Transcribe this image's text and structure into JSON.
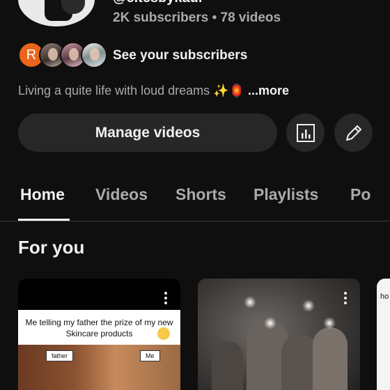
{
  "channel": {
    "handle": "@citesbykaur",
    "stats": "2K subscribers • 78 videos",
    "see_subscribers": "See your subscribers",
    "subscriber_initial": "R",
    "bio": "Living a quite life with loud dreams ✨🏮",
    "more": "...more"
  },
  "actions": {
    "manage_videos": "Manage videos"
  },
  "tabs": [
    {
      "label": "Home"
    },
    {
      "label": "Videos"
    },
    {
      "label": "Shorts"
    },
    {
      "label": "Playlists"
    },
    {
      "label": "Po"
    }
  ],
  "section": {
    "title": "For you"
  },
  "cards": [
    {
      "caption": "Me telling my father the prize of my new Skincare products",
      "label_left": "father",
      "label_right": "Me"
    },
    {},
    {
      "caption_partial": "ho"
    }
  ],
  "colors": {
    "background": "#0f0f0f",
    "button": "#272727",
    "avatar_accent": "#e9651b",
    "muted_text": "#aaaaaa"
  },
  "icons": [
    "kebab-menu-icon",
    "analytics-icon",
    "edit-pencil-icon"
  ]
}
